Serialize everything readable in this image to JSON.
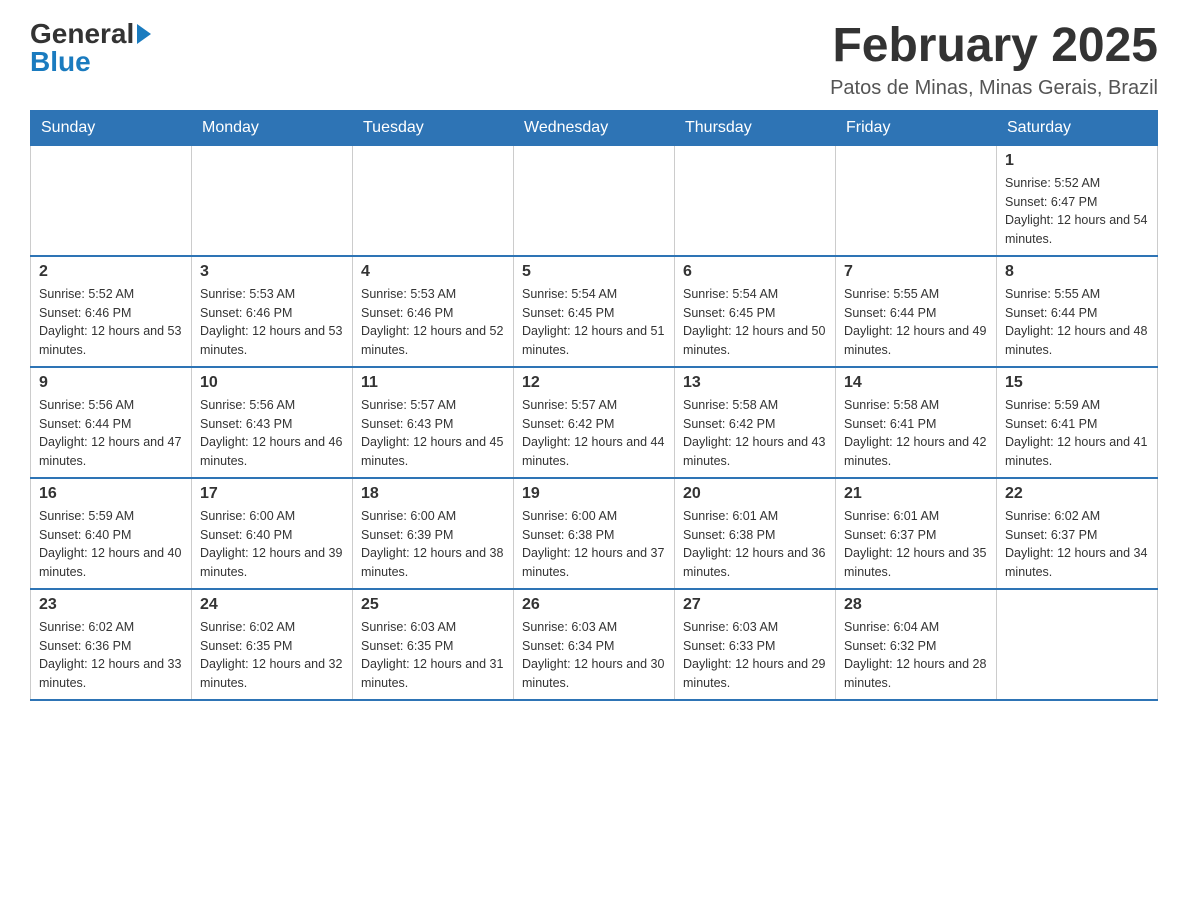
{
  "logo": {
    "general": "General",
    "blue": "Blue",
    "arrow": "▶"
  },
  "title": "February 2025",
  "location": "Patos de Minas, Minas Gerais, Brazil",
  "days_of_week": [
    "Sunday",
    "Monday",
    "Tuesday",
    "Wednesday",
    "Thursday",
    "Friday",
    "Saturday"
  ],
  "weeks": [
    [
      {
        "day": "",
        "info": ""
      },
      {
        "day": "",
        "info": ""
      },
      {
        "day": "",
        "info": ""
      },
      {
        "day": "",
        "info": ""
      },
      {
        "day": "",
        "info": ""
      },
      {
        "day": "",
        "info": ""
      },
      {
        "day": "1",
        "info": "Sunrise: 5:52 AM\nSunset: 6:47 PM\nDaylight: 12 hours and 54 minutes."
      }
    ],
    [
      {
        "day": "2",
        "info": "Sunrise: 5:52 AM\nSunset: 6:46 PM\nDaylight: 12 hours and 53 minutes."
      },
      {
        "day": "3",
        "info": "Sunrise: 5:53 AM\nSunset: 6:46 PM\nDaylight: 12 hours and 53 minutes."
      },
      {
        "day": "4",
        "info": "Sunrise: 5:53 AM\nSunset: 6:46 PM\nDaylight: 12 hours and 52 minutes."
      },
      {
        "day": "5",
        "info": "Sunrise: 5:54 AM\nSunset: 6:45 PM\nDaylight: 12 hours and 51 minutes."
      },
      {
        "day": "6",
        "info": "Sunrise: 5:54 AM\nSunset: 6:45 PM\nDaylight: 12 hours and 50 minutes."
      },
      {
        "day": "7",
        "info": "Sunrise: 5:55 AM\nSunset: 6:44 PM\nDaylight: 12 hours and 49 minutes."
      },
      {
        "day": "8",
        "info": "Sunrise: 5:55 AM\nSunset: 6:44 PM\nDaylight: 12 hours and 48 minutes."
      }
    ],
    [
      {
        "day": "9",
        "info": "Sunrise: 5:56 AM\nSunset: 6:44 PM\nDaylight: 12 hours and 47 minutes."
      },
      {
        "day": "10",
        "info": "Sunrise: 5:56 AM\nSunset: 6:43 PM\nDaylight: 12 hours and 46 minutes."
      },
      {
        "day": "11",
        "info": "Sunrise: 5:57 AM\nSunset: 6:43 PM\nDaylight: 12 hours and 45 minutes."
      },
      {
        "day": "12",
        "info": "Sunrise: 5:57 AM\nSunset: 6:42 PM\nDaylight: 12 hours and 44 minutes."
      },
      {
        "day": "13",
        "info": "Sunrise: 5:58 AM\nSunset: 6:42 PM\nDaylight: 12 hours and 43 minutes."
      },
      {
        "day": "14",
        "info": "Sunrise: 5:58 AM\nSunset: 6:41 PM\nDaylight: 12 hours and 42 minutes."
      },
      {
        "day": "15",
        "info": "Sunrise: 5:59 AM\nSunset: 6:41 PM\nDaylight: 12 hours and 41 minutes."
      }
    ],
    [
      {
        "day": "16",
        "info": "Sunrise: 5:59 AM\nSunset: 6:40 PM\nDaylight: 12 hours and 40 minutes."
      },
      {
        "day": "17",
        "info": "Sunrise: 6:00 AM\nSunset: 6:40 PM\nDaylight: 12 hours and 39 minutes."
      },
      {
        "day": "18",
        "info": "Sunrise: 6:00 AM\nSunset: 6:39 PM\nDaylight: 12 hours and 38 minutes."
      },
      {
        "day": "19",
        "info": "Sunrise: 6:00 AM\nSunset: 6:38 PM\nDaylight: 12 hours and 37 minutes."
      },
      {
        "day": "20",
        "info": "Sunrise: 6:01 AM\nSunset: 6:38 PM\nDaylight: 12 hours and 36 minutes."
      },
      {
        "day": "21",
        "info": "Sunrise: 6:01 AM\nSunset: 6:37 PM\nDaylight: 12 hours and 35 minutes."
      },
      {
        "day": "22",
        "info": "Sunrise: 6:02 AM\nSunset: 6:37 PM\nDaylight: 12 hours and 34 minutes."
      }
    ],
    [
      {
        "day": "23",
        "info": "Sunrise: 6:02 AM\nSunset: 6:36 PM\nDaylight: 12 hours and 33 minutes."
      },
      {
        "day": "24",
        "info": "Sunrise: 6:02 AM\nSunset: 6:35 PM\nDaylight: 12 hours and 32 minutes."
      },
      {
        "day": "25",
        "info": "Sunrise: 6:03 AM\nSunset: 6:35 PM\nDaylight: 12 hours and 31 minutes."
      },
      {
        "day": "26",
        "info": "Sunrise: 6:03 AM\nSunset: 6:34 PM\nDaylight: 12 hours and 30 minutes."
      },
      {
        "day": "27",
        "info": "Sunrise: 6:03 AM\nSunset: 6:33 PM\nDaylight: 12 hours and 29 minutes."
      },
      {
        "day": "28",
        "info": "Sunrise: 6:04 AM\nSunset: 6:32 PM\nDaylight: 12 hours and 28 minutes."
      },
      {
        "day": "",
        "info": ""
      }
    ]
  ]
}
